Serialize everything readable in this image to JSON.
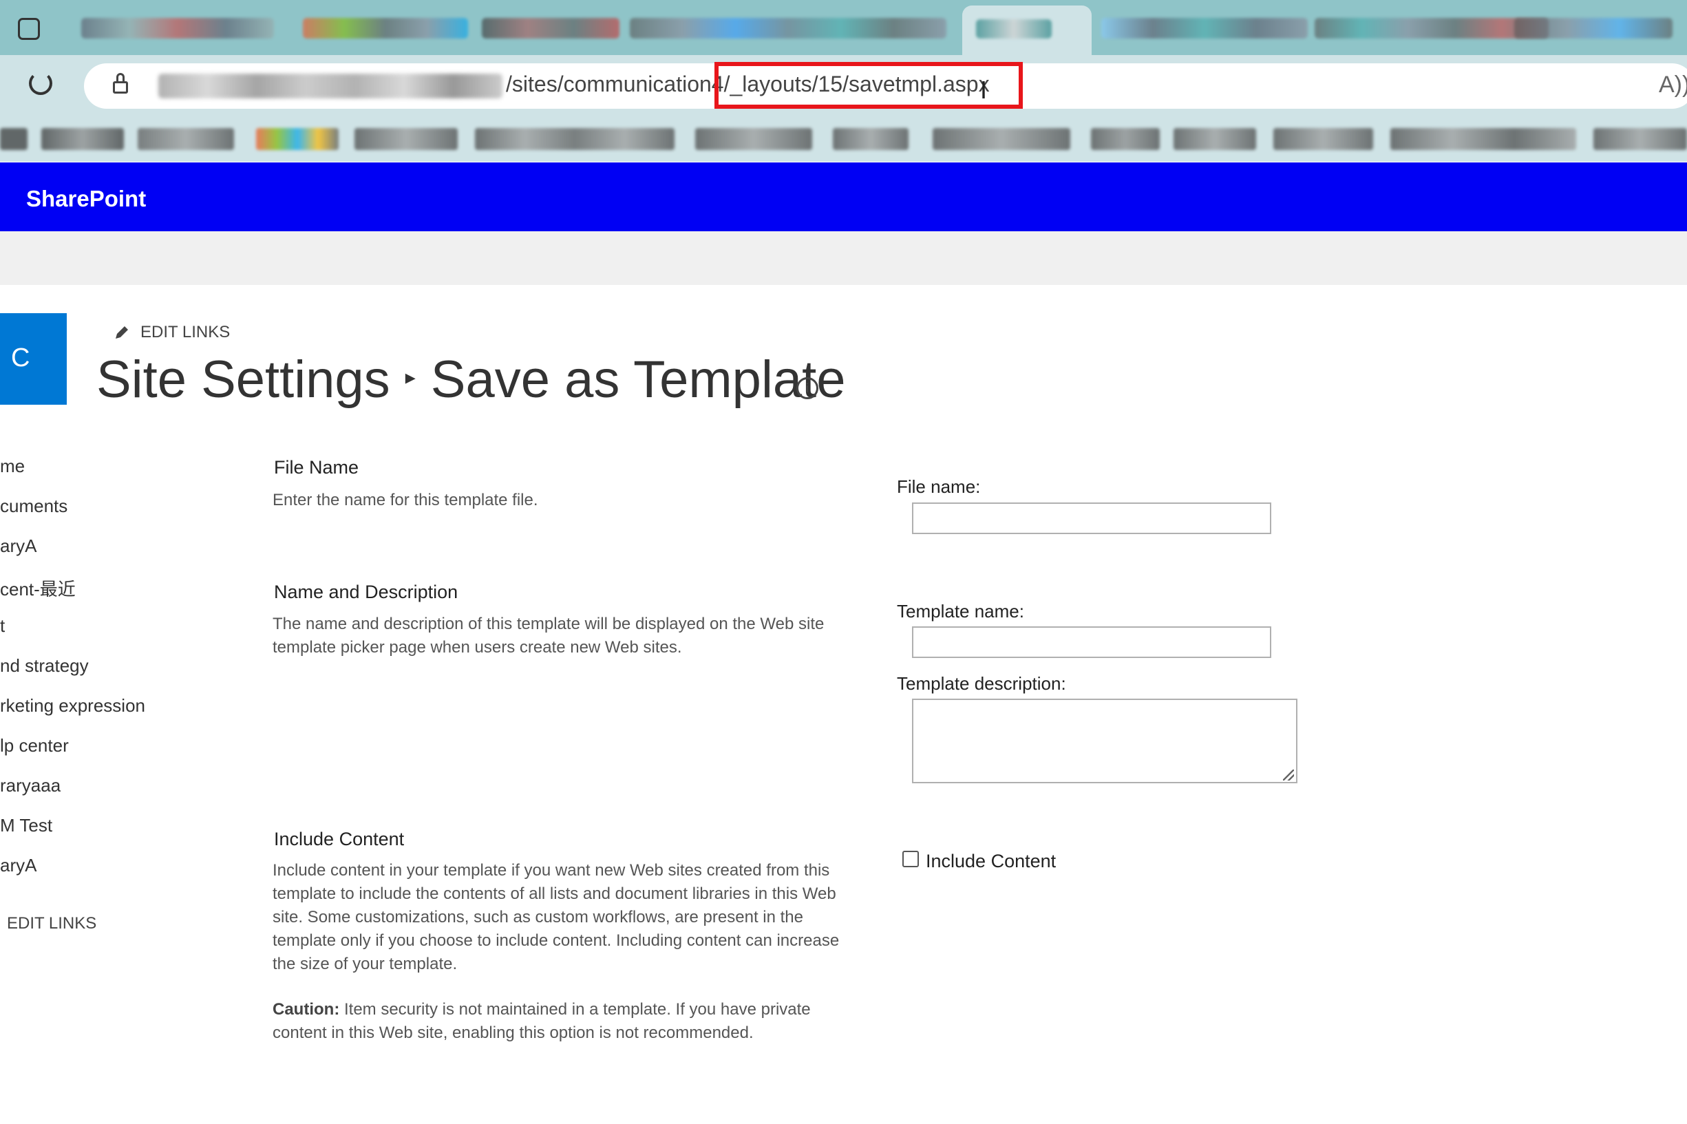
{
  "browser": {
    "url_visible": "/sites/communication4/_layouts/15/savetmpl.aspx",
    "read_aloud_icon": "A))"
  },
  "suite": {
    "brand": "SharePoint"
  },
  "site": {
    "logo_letter": "C",
    "edit_links_top": "EDIT LINKS",
    "breadcrumb": {
      "parent": "Site Settings",
      "separator": "▸",
      "current": "Save as Template"
    },
    "info_icon": "i"
  },
  "nav": {
    "items": [
      "me",
      "cuments",
      "aryA",
      "cent-最近",
      "t",
      "nd strategy",
      "rketing expression",
      "lp center",
      "raryaaa",
      "M Test",
      "aryA"
    ],
    "edit_links": "EDIT LINKS"
  },
  "sections": {
    "file": {
      "title": "File Name",
      "desc": "Enter the name for this template file.",
      "label": "File name:",
      "value": ""
    },
    "name": {
      "title": "Name and Description",
      "desc": "The name and description of this template will be displayed on the Web site template picker page when users create new Web sites.",
      "name_label": "Template name:",
      "name_value": "",
      "desc_label": "Template description:",
      "desc_value": ""
    },
    "include": {
      "title": "Include Content",
      "desc": "Include content in your template if you want new Web sites created from this template to include the contents of all lists and document libraries in this Web site. Some customizations, such as custom workflows, are present in the template only if you choose to include content. Including content can increase the size of your template.",
      "caution_label": "Caution:",
      "caution_text": " Item security is not maintained in a template. If you have private content in this Web site, enabling this option is not recommended.",
      "checkbox_label": "Include Content",
      "checked": false
    }
  },
  "colors": {
    "suite_bar": "#0000f4",
    "highlight": "#e8161b",
    "logo_tile": "#0078d4"
  }
}
